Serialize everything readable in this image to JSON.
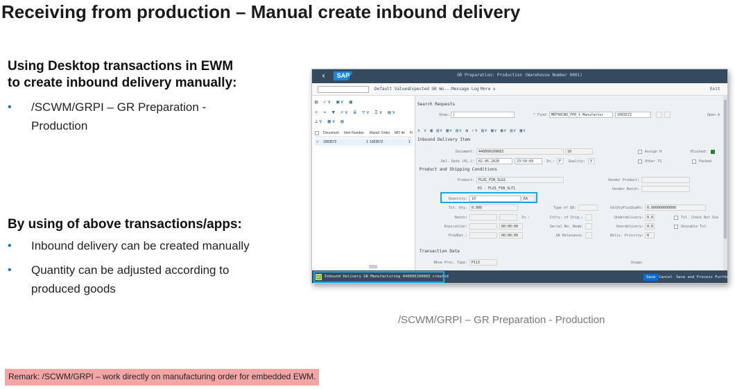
{
  "slide": {
    "title": "Receiving from production – Manual create inbound delivery",
    "section1_heading_line1": "Using Desktop transactions in EWM",
    "section1_heading_line2": "to create inbound delivery manually:",
    "section1_bullets": [
      "/SCWM/GRPI – GR Preparation - Production"
    ],
    "section2_heading": "By using of above transactions/apps:",
    "section2_bullets": [
      "Inbound delivery can be created manually",
      "Quantity can be adjusted according to produced goods"
    ],
    "bullet_char": "•",
    "caption": "/SCWM/GRPI – GR Preparation - Production",
    "remark": "Remark: /SCWM/GRPI – work directly on manufacturing order for embedded EWM."
  },
  "sap": {
    "logo": "SAP",
    "back": "‹",
    "window_title": "GR Preparation: Production (Warehouse Number 0001)",
    "toolbar": {
      "default_values": "Default Values",
      "expected_gr": "Expected GR Wo...",
      "message_log": "Message Log",
      "more": "More ∨",
      "exit": "Exit"
    },
    "left": {
      "icons_row1": "▤ ✓∨ ▣∨ ▦",
      "icons_row2": "⌕ ⌖ ▼ ⌕∨ ≣ ▽∨ Σ∨ ▤∨",
      "icons_row3": "⊥∨ ▦∨ ▤",
      "columns": [
        "Document",
        "Item Number",
        "Manuf. Order",
        "MO Ite",
        "Fi"
      ],
      "row": [
        "1003572",
        "1",
        "1003572",
        "1"
      ]
    },
    "search": {
      "section": "Search Requests",
      "show_label": "Show:",
      "show_value": "|",
      "find_label": "* Find:",
      "find_value": "MEF00CNO_FPO_1 Manufactur",
      "find_input": "1003572",
      "open_label": "Open A"
    },
    "item": {
      "icons": "∧ ∨ ▣ ▤∨ ▦∨ ▤∨ ◑ ✓∨ ▤∨ ▦∨ ▣∨ ▤∨ ▦∨",
      "section": "Inbound Delivery Item",
      "document_label": "Document:",
      "document_value": "440000109083",
      "item_value": "10",
      "assign_label": "Assign H",
      "blocked_label": "Blocked:",
      "del_date_label": "Del. Date (PL.):",
      "del_date_value": "02.06.2020",
      "del_time_value": "23:50:09",
      "in_label": "In.:",
      "in_value": "F",
      "quality_label": "Quality:",
      "quality_value": "Y",
      "other_label": "Other TS",
      "packed_label": "Packed",
      "product_section": "Product and Shipping Conditions",
      "product_label": "Product:",
      "product_value": "FLO1_FIN_SLG1",
      "product_desc": "ES - FLO1_FIN_SLT1",
      "vendor_product_label": "Vendor Product:",
      "vendor_batch_label": "Vendor Batch:",
      "quantity_label": "Quantity:",
      "quantity_value": "10",
      "quantity_uom": "EA",
      "tol_label": "Tol. Qty:",
      "tol_value": "0.000",
      "type_gr_label": "Type of GR:",
      "valqty_label": "ValQtyPlusQuaPo:",
      "valqty_value": "0.000000000000",
      "batch_label": "Batch:",
      "in2_label": "In.:",
      "coo_label": "Cntry. of Orig.:",
      "underdel_label": "Underdelivery:",
      "underdel_value": "0.0",
      "tol_check_label": "Tol. Check Not Use",
      "expiration_label": "Expiration:",
      "expiration_time": "00:00:00",
      "serial_label": "Serial No. Reqm:",
      "overdel_label": "Overdelivery:",
      "overdel_value": "0.0",
      "unusable_label": "Unusable Tol.",
      "prod_date_label": "ProdDat.:",
      "prod_time": "00:00:00",
      "gr_relevance_label": "GR Relevance:",
      "deliv_priority_label": "Deliv. Priority:",
      "deliv_priority_value": "0",
      "transaction_section": "Transaction Data",
      "whse_proc_label": "Whse Proc. Type:",
      "whse_proc_value": "P113",
      "usage_label": "Usage:"
    },
    "status": {
      "check": "✓",
      "message": "Inbound Delivery GR Manufacturing 440000109083 created",
      "save": "Save",
      "cancel": "Cancel",
      "save_process": "Save and Process Further"
    }
  }
}
